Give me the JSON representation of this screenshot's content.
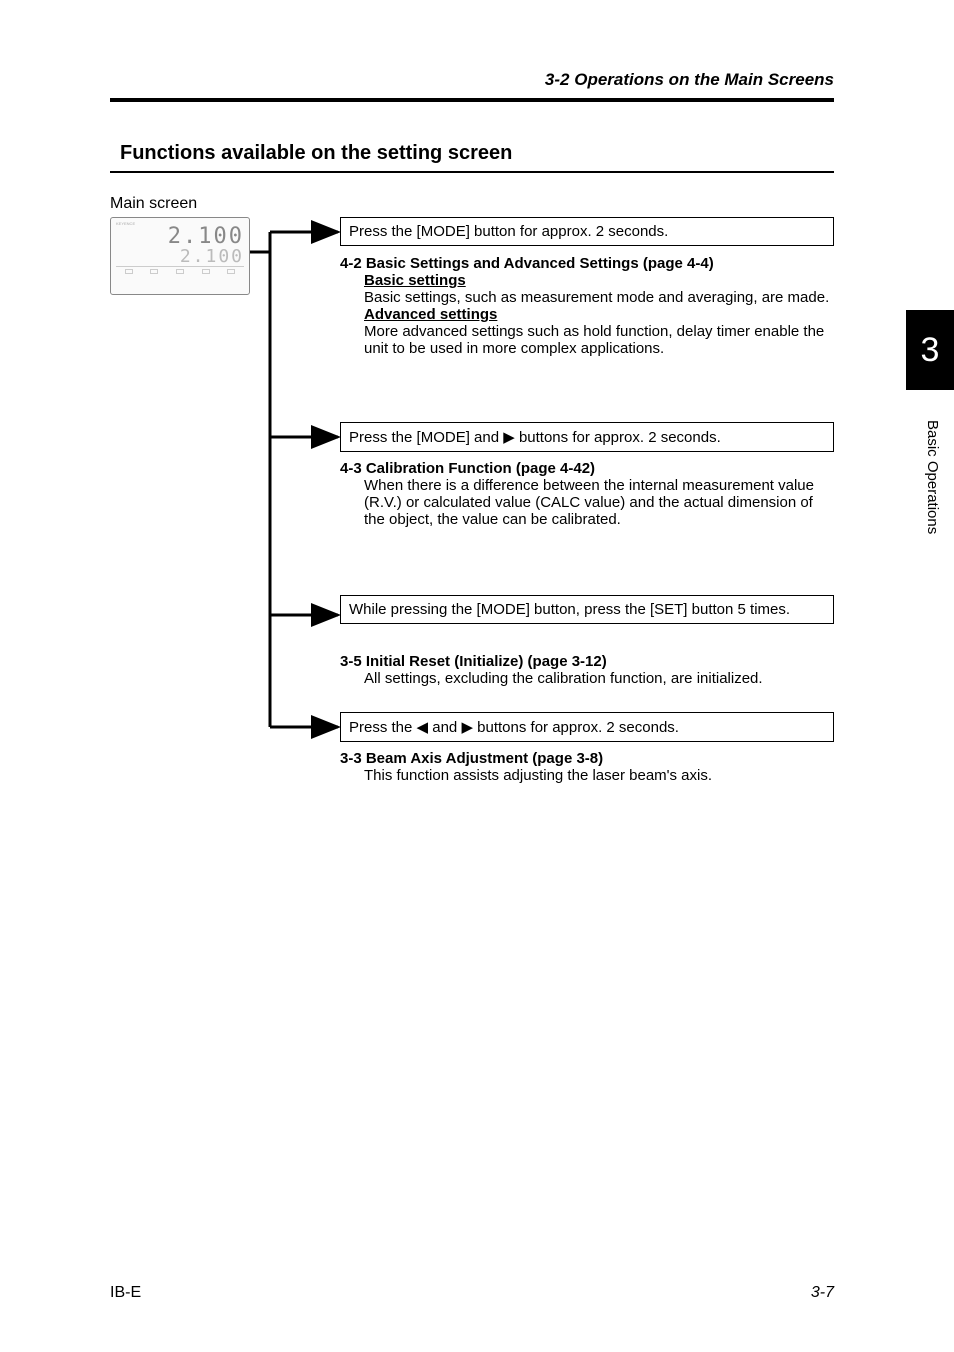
{
  "header": {
    "section_title": "3-2  Operations on the Main Screens"
  },
  "title": "Functions available on the setting screen",
  "main_screen_label": "Main screen",
  "device": {
    "line1": "2.100",
    "line2": "2.100"
  },
  "boxes": {
    "b1": "Press the [MODE] button for approx. 2 seconds.",
    "b2_pre": "Press the [MODE] and ",
    "b2_post": " buttons for approx. 2 seconds.",
    "b3": "While pressing the [MODE] button, press the [SET] button 5 times.",
    "b4_pre": "Press the ",
    "b4_mid": " and ",
    "b4_post": " buttons for approx. 2 seconds."
  },
  "info1": {
    "heading": "4-2 Basic Settings and Advanced Settings (page 4-4)",
    "sub1": "Basic settings",
    "body1": "Basic settings, such as measurement mode and averaging, are made.",
    "sub2": "Advanced settings",
    "body2": "More advanced settings such as hold function, delay timer enable the unit to be used in more complex applications."
  },
  "info2": {
    "heading": "4-3 Calibration Function (page 4-42)",
    "body": "When there is a difference between the internal measurement value (R.V.) or calculated value (CALC value) and the actual dimension of the object, the value can be calibrated."
  },
  "info3": {
    "heading": "3-5 Initial Reset (Initialize) (page 3-12)",
    "body": "All settings, excluding the calibration function, are initialized."
  },
  "info4": {
    "heading": "3-3 Beam Axis Adjustment (page 3-8)",
    "body": "This function assists adjusting the laser beam's axis."
  },
  "glyphs": {
    "right": "▶",
    "left": "◀"
  },
  "side": {
    "num": "3",
    "label": "Basic Operations"
  },
  "footer": {
    "left": "IB-E",
    "right": "3-7"
  }
}
